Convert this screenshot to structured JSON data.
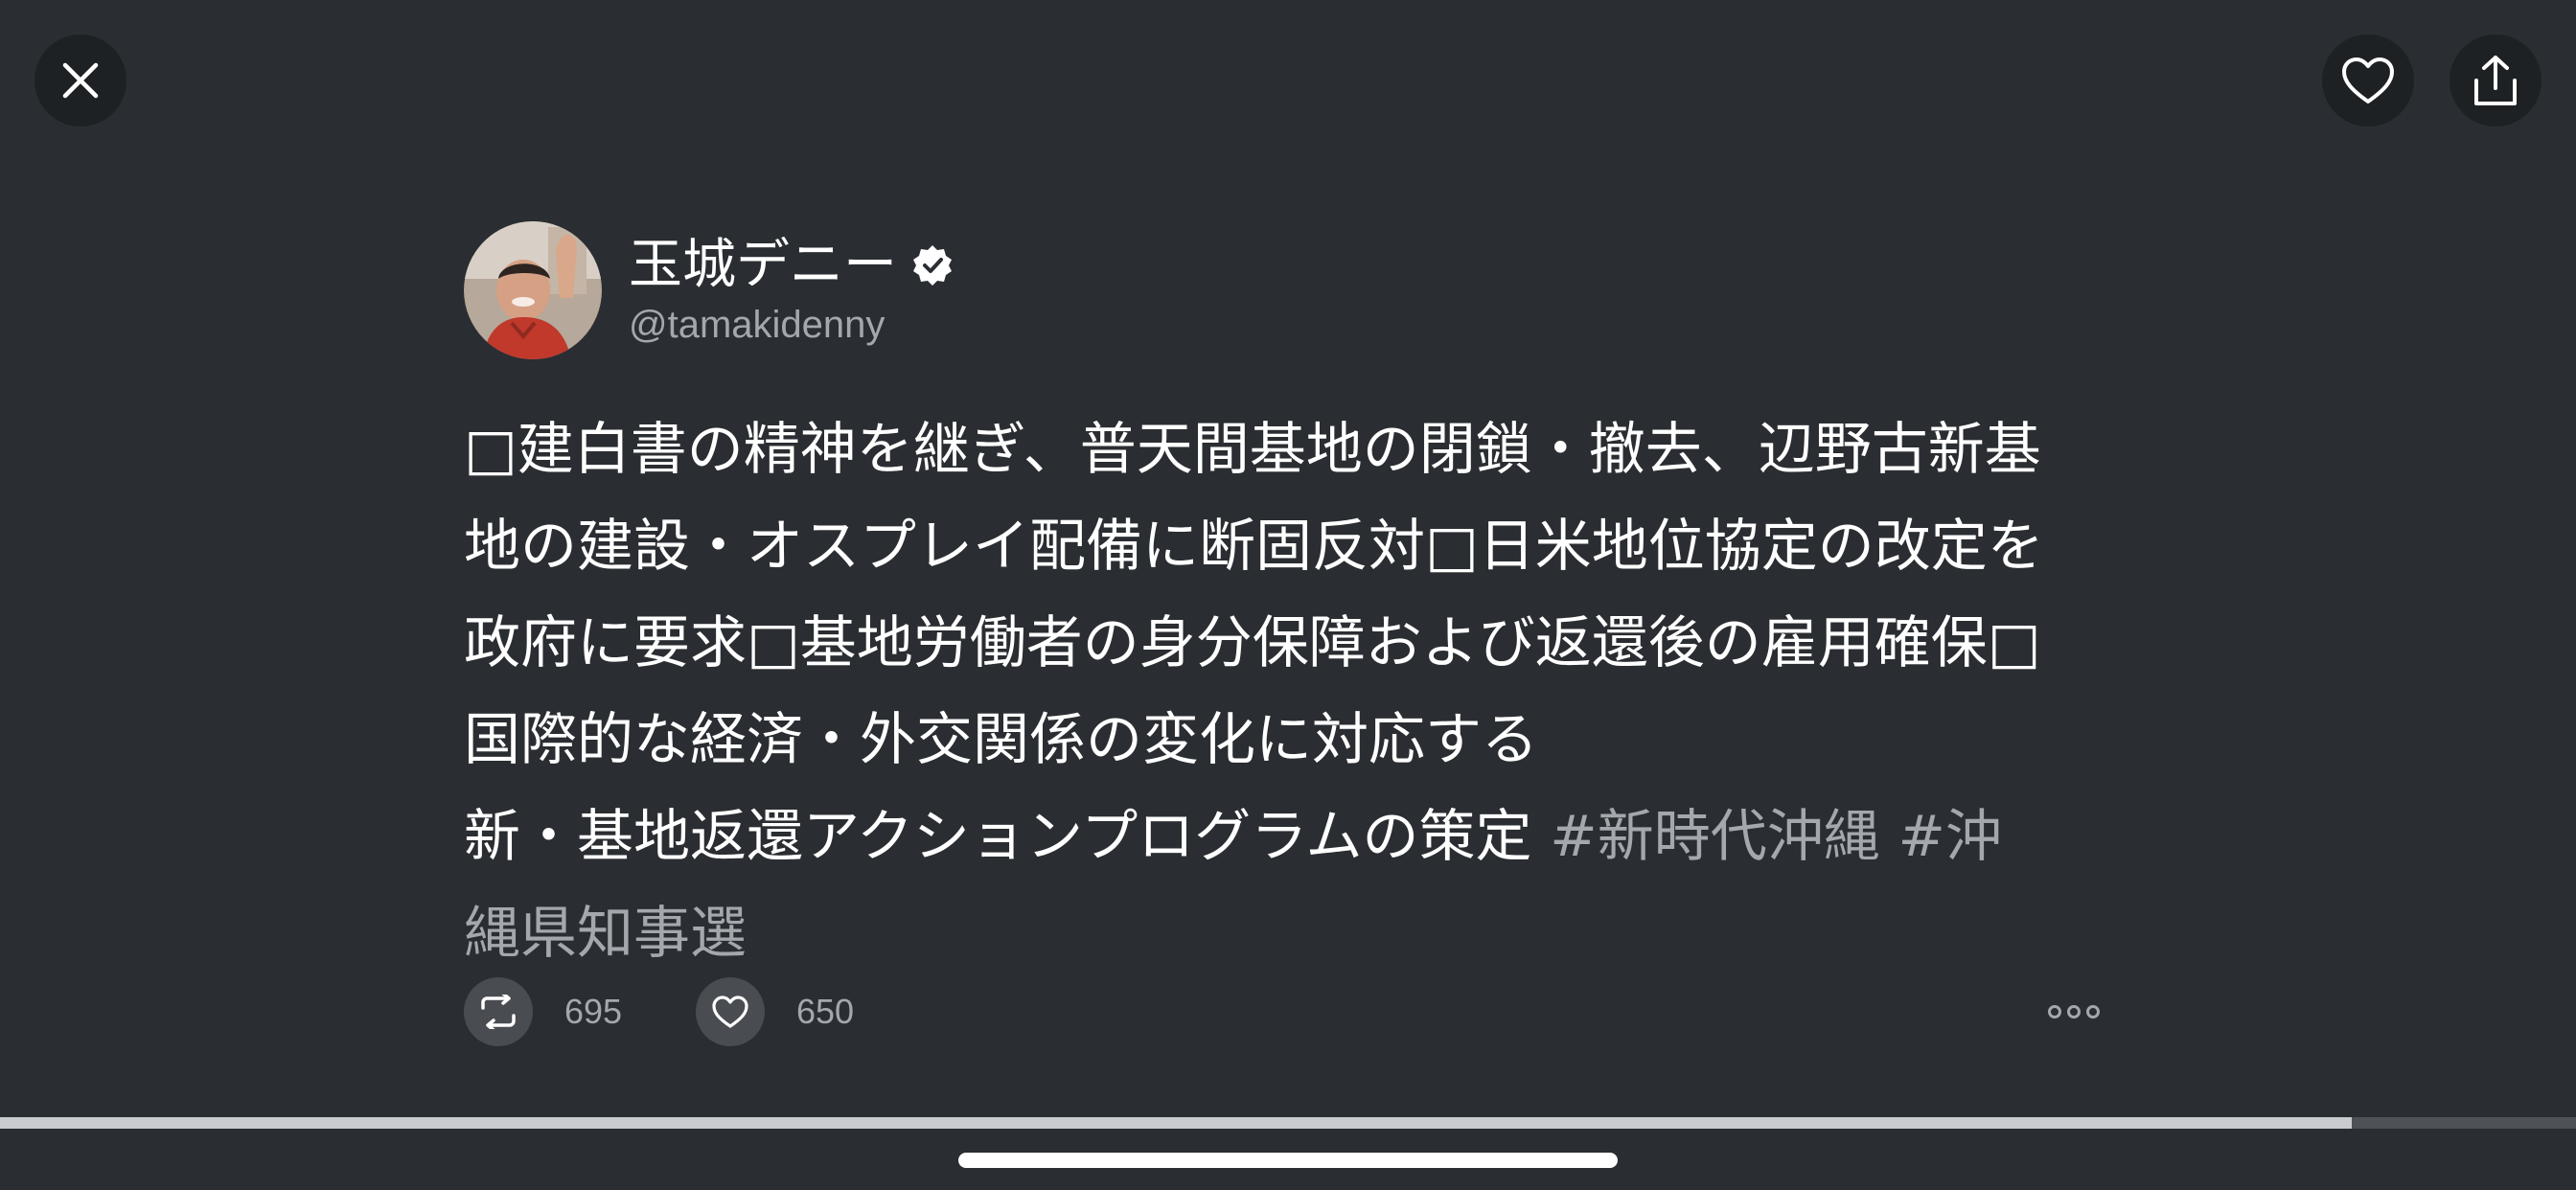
{
  "top_bar": {
    "close_icon": "close-icon",
    "favorite_icon": "heart-icon",
    "share_icon": "share-icon"
  },
  "tweet": {
    "display_name": "玉城デニー",
    "verified_icon": "verified-badge-icon",
    "handle": "@tamakidenny",
    "text": "□建白書の精神を継ぎ、普天間基地の閉鎖・撤去、辺野古新基地の建設・オスプレイ配備に断固反対□日米地位協定の改定を政府に要求□基地労働者の身分保障および返還後の雇用確保□国際的な経済・外交関係の変化に対応する\n新・基地返還アクションプログラムの策定 ",
    "hashtags": [
      "#新時代沖縄",
      "#沖縄県知事選"
    ],
    "retweet_count": "695",
    "like_count": "650",
    "more_icon": "more-options-icon"
  },
  "playback": {
    "progress": 0.913
  },
  "colors": {
    "background": "#2a2d31",
    "secondary_text": "#a4a7ab",
    "button_bg": "#1e2124",
    "action_bg": "#494c51"
  }
}
